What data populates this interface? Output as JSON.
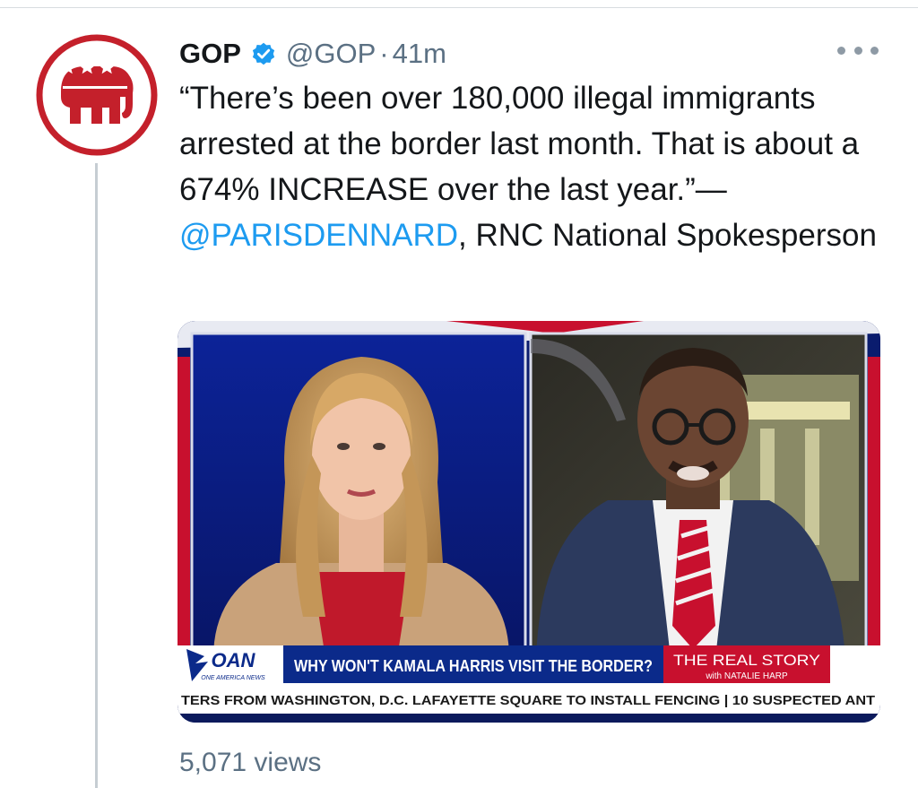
{
  "author": {
    "display_name": "GOP",
    "handle": "@GOP",
    "separator": "·",
    "time": "41m"
  },
  "tweet": {
    "text_before": "“There’s been over 180,000 illegal immigrants arrested at the border last month. That is about a 674% INCREASE over the last year.”—",
    "mention": "@PARISDENNARD",
    "text_after": ", RNC National Spokesperson"
  },
  "media": {
    "network_logo": "OAN",
    "network_tagline": "ONE AMERICA NEWS",
    "headline": "WHY WON'T KAMALA HARRIS VISIT THE BORDER?",
    "show_title": "THE REAL STORY",
    "show_host": "with NATALIE HARP",
    "ticker": "TERS FROM WASHINGTON, D.C. LAFAYETTE SQUARE TO INSTALL FENCING | 10 SUSPECTED ANT"
  },
  "stats": {
    "views": "5,071 views"
  },
  "colors": {
    "gop_red": "#c4202b",
    "verified_blue": "#1d9bf0",
    "mention_blue": "#1d9bf0",
    "oan_red": "#c8102e",
    "oan_blue": "#0b2a8a"
  }
}
